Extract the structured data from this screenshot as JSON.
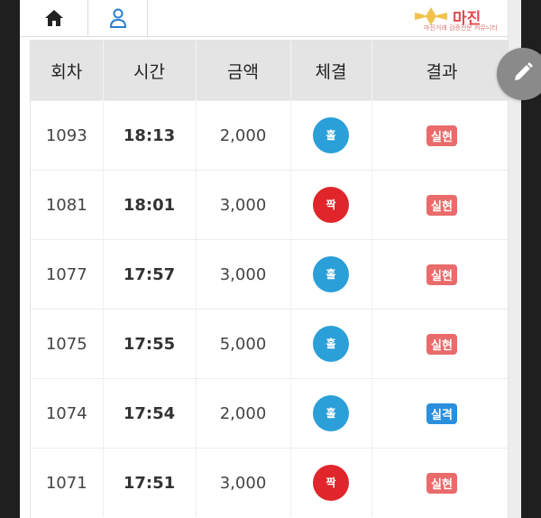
{
  "logo": {
    "title": "마진",
    "subtitle": "마진거래 검증전문 커뮤니티"
  },
  "table": {
    "headers": [
      "회차",
      "시간",
      "금액",
      "체결",
      "결과"
    ],
    "rows": [
      {
        "round": "1093",
        "time": "18:13",
        "amount": "2,000",
        "fill": "홀",
        "result": "실현"
      },
      {
        "round": "1081",
        "time": "18:01",
        "amount": "3,000",
        "fill": "짝",
        "result": "실현"
      },
      {
        "round": "1077",
        "time": "17:57",
        "amount": "3,000",
        "fill": "홀",
        "result": "실현"
      },
      {
        "round": "1075",
        "time": "17:55",
        "amount": "5,000",
        "fill": "홀",
        "result": "실현"
      },
      {
        "round": "1074",
        "time": "17:54",
        "amount": "2,000",
        "fill": "홀",
        "result": "실격"
      },
      {
        "round": "1071",
        "time": "17:51",
        "amount": "3,000",
        "fill": "짝",
        "result": "실현"
      }
    ]
  },
  "colors": {
    "odd": "#2a9fd8",
    "even": "#e0262a",
    "success": "#e96b6b",
    "fail": "#2a8fdc",
    "header_bg": "#e4e4e4",
    "accent": "#2a7fd4"
  },
  "icons": {
    "home": "home-icon",
    "user": "user-icon",
    "edit": "pencil-icon"
  }
}
